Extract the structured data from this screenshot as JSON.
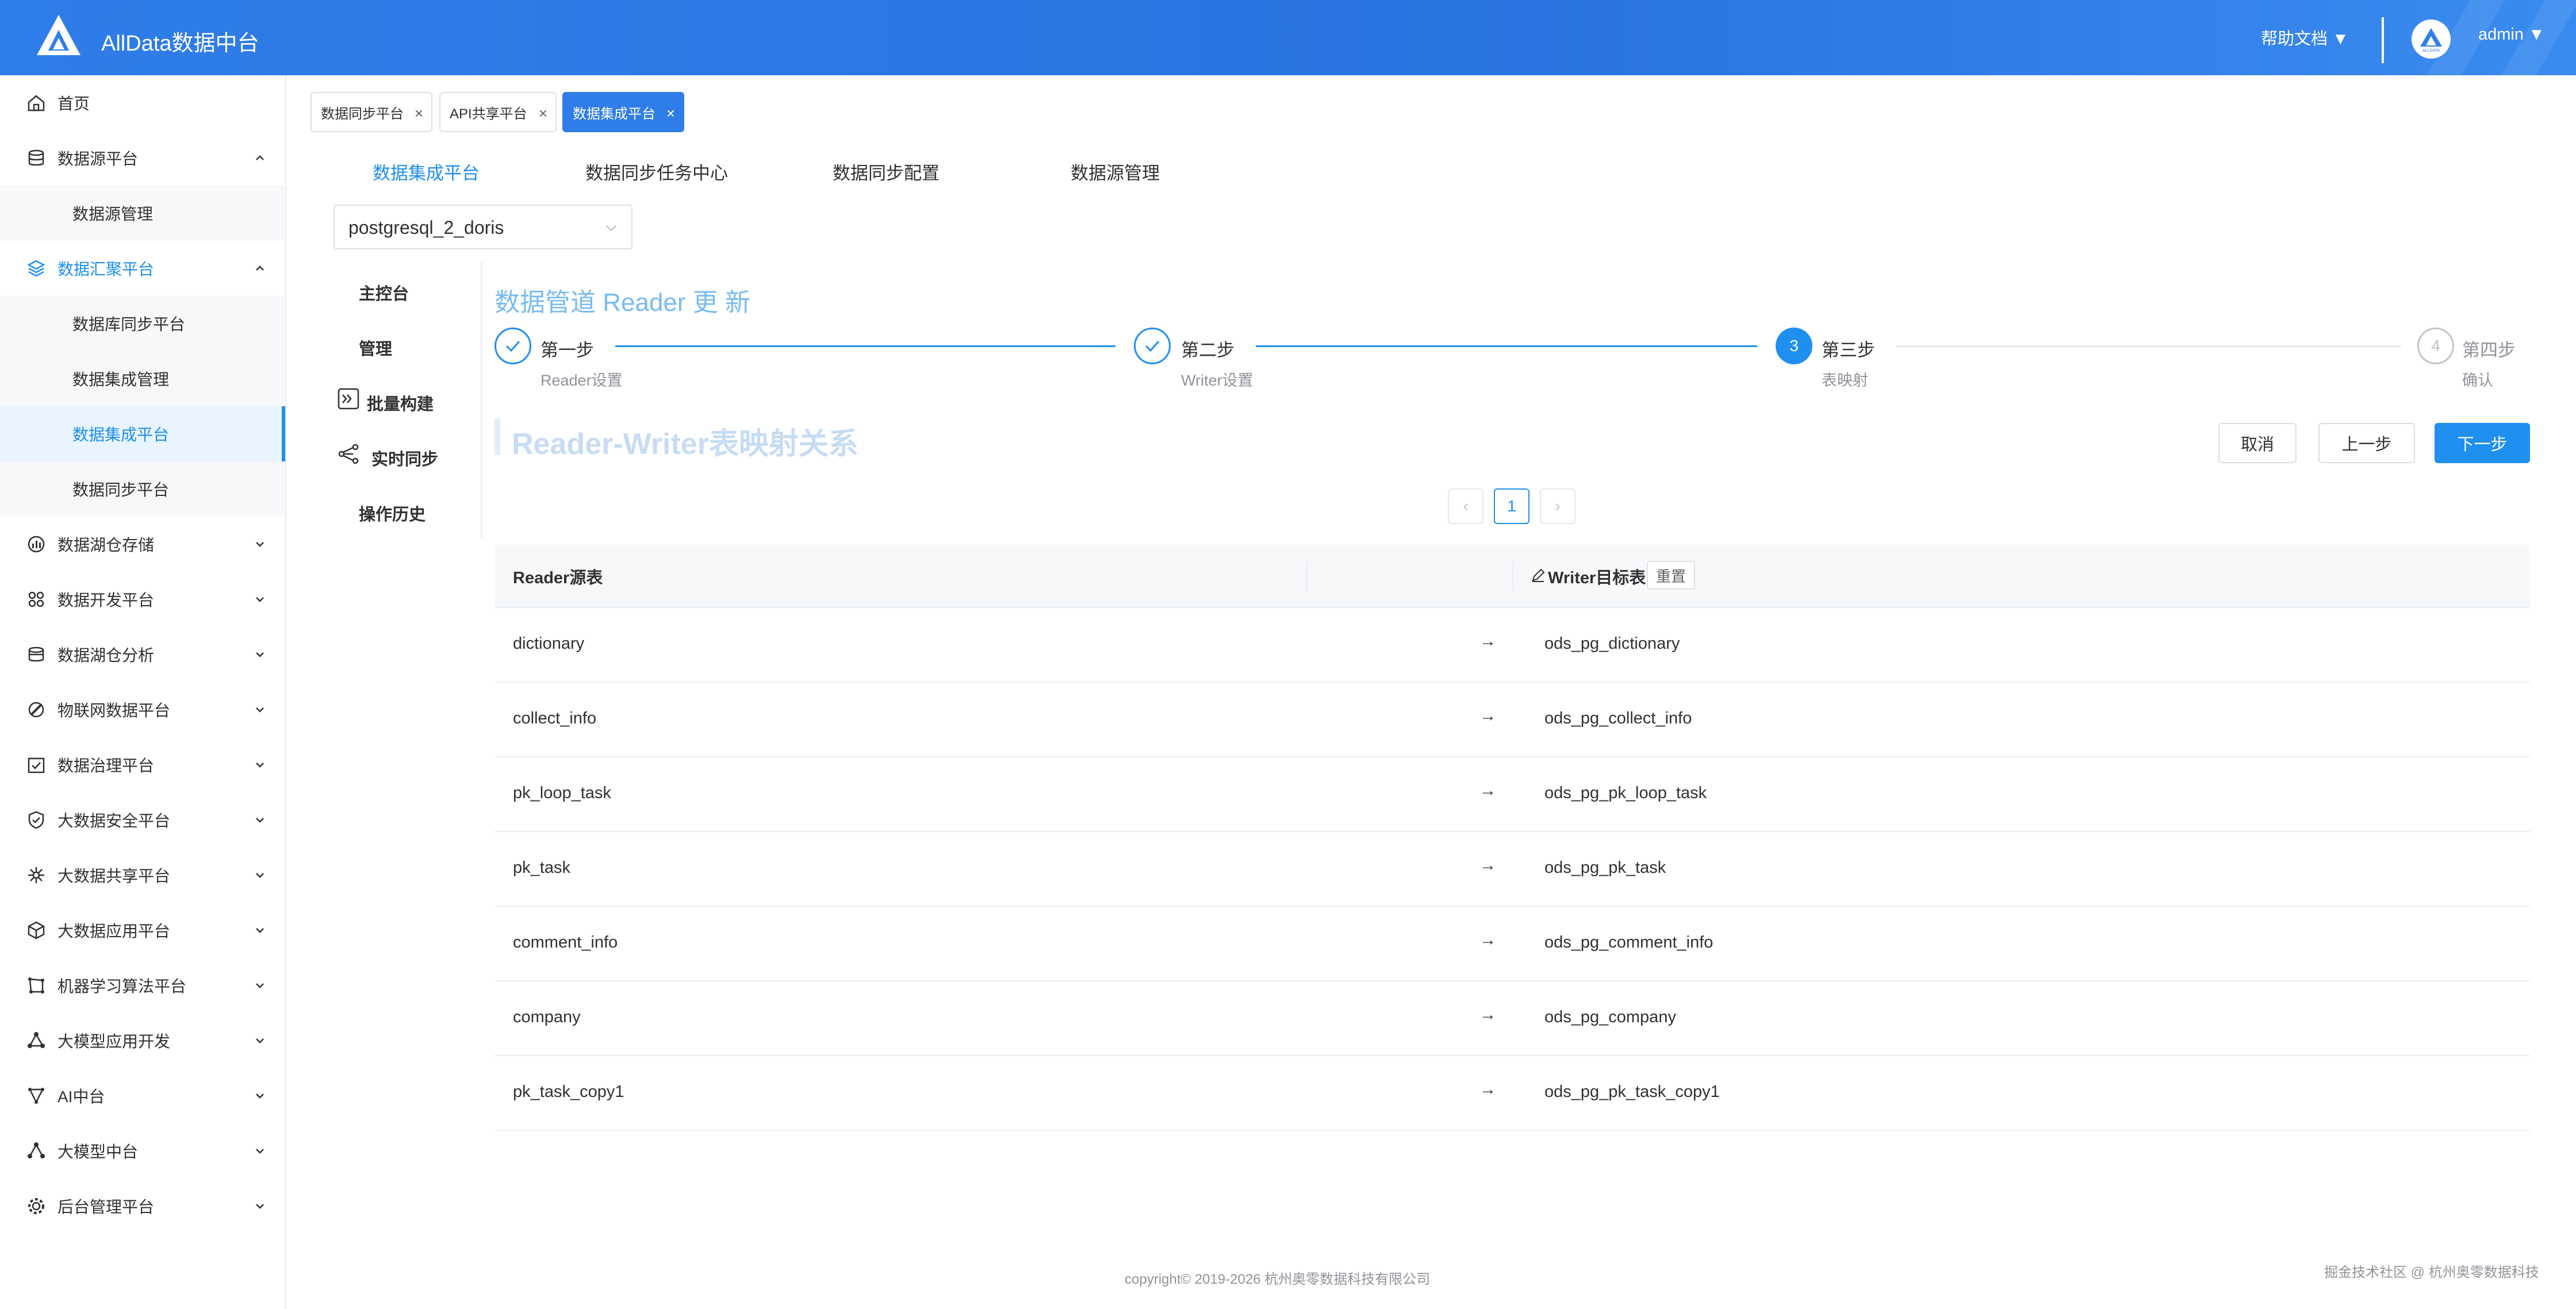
{
  "header": {
    "app_title": "AllData数据中台",
    "help_label": "帮助文档 ▼",
    "user_label": "admin ▼",
    "avatar_text": "ALLDATA"
  },
  "sidebar": {
    "items": [
      {
        "label": "首页"
      },
      {
        "label": "数据源平台"
      },
      {
        "label": "数据源管理"
      },
      {
        "label": "数据汇聚平台"
      },
      {
        "label": "数据库同步平台"
      },
      {
        "label": "数据集成管理"
      },
      {
        "label": "数据集成平台"
      },
      {
        "label": "数据同步平台"
      },
      {
        "label": "数据湖仓存储"
      },
      {
        "label": "数据开发平台"
      },
      {
        "label": "数据湖仓分析"
      },
      {
        "label": "物联网数据平台"
      },
      {
        "label": "数据治理平台"
      },
      {
        "label": "大数据安全平台"
      },
      {
        "label": "大数据共享平台"
      },
      {
        "label": "大数据应用平台"
      },
      {
        "label": "机器学习算法平台"
      },
      {
        "label": "大模型应用开发"
      },
      {
        "label": "AI中台"
      },
      {
        "label": "大模型中台"
      },
      {
        "label": "后台管理平台"
      }
    ]
  },
  "tags": [
    "数据同步平台",
    "API共享平台",
    "数据集成平台"
  ],
  "top_tabs": [
    "数据集成平台",
    "数据同步任务中心",
    "数据同步配置",
    "数据源管理"
  ],
  "select": {
    "value": "postgresql_2_doris"
  },
  "sub_nav": [
    "主控台",
    "管理",
    "批量构建",
    "实时同步",
    "操作历史"
  ],
  "form_title": "数据管道 Reader 更 新",
  "steps": [
    {
      "title": "第一步",
      "desc": "Reader设置",
      "status": "done"
    },
    {
      "title": "第二步",
      "desc": "Writer设置",
      "status": "done"
    },
    {
      "title": "第三步",
      "desc": "表映射",
      "status": "current",
      "number": "3"
    },
    {
      "title": "第四步",
      "desc": "确认",
      "status": "wait",
      "number": "4"
    }
  ],
  "section_title": "Reader-Writer表映射关系",
  "buttons": {
    "cancel": "取消",
    "prev": "上一步",
    "next": "下一步"
  },
  "pagination": {
    "prev": "‹",
    "current": "1",
    "next": "›"
  },
  "table": {
    "col_reader": "Reader源表",
    "col_writer": "Writer目标表",
    "reset": "重置",
    "arrow": "→",
    "rows": [
      {
        "reader": "dictionary",
        "writer": "ods_pg_dictionary"
      },
      {
        "reader": "collect_info",
        "writer": "ods_pg_collect_info"
      },
      {
        "reader": "pk_loop_task",
        "writer": "ods_pg_pk_loop_task"
      },
      {
        "reader": "pk_task",
        "writer": "ods_pg_pk_task"
      },
      {
        "reader": "comment_info",
        "writer": "ods_pg_comment_info"
      },
      {
        "reader": "company",
        "writer": "ods_pg_company"
      },
      {
        "reader": "pk_task_copy1",
        "writer": "ods_pg_pk_task_copy1"
      }
    ]
  },
  "footer": {
    "copyright": "copyright© 2019-2026 杭州奥零数据科技有限公司",
    "watermark": "掘金技术社区 @ 杭州奥零数据科技"
  },
  "colors": {
    "primary": "#1f8ff0",
    "header": "#2f7de8"
  }
}
